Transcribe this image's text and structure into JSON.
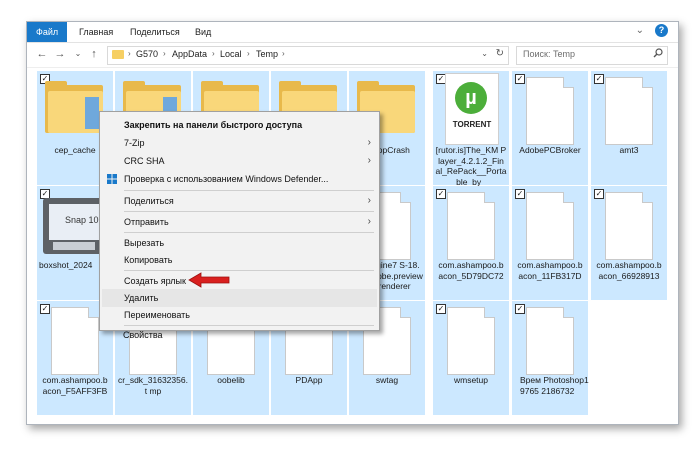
{
  "ribbon": {
    "tabs": [
      "Файл",
      "Главная",
      "Поделиться",
      "Вид"
    ],
    "collapse_icon": "chevron-down-icon",
    "help_label": "?"
  },
  "address": {
    "breadcrumb": [
      "G570",
      "AppData",
      "Local",
      "Temp"
    ],
    "search_placeholder": "Поиск: Temp"
  },
  "files": [
    {
      "label": "cep_cache",
      "type": "folder",
      "checked": true
    },
    {
      "label": "",
      "type": "folder",
      "checked": false
    },
    {
      "label": "",
      "type": "folder",
      "checked": false
    },
    {
      "label": "",
      "type": "folder",
      "checked": false
    },
    {
      "label": "oshopCrash",
      "type": "folder",
      "checked": false
    },
    {
      "label": "[rutor.is]The_KM Player_4.2.1.2_Fin al_RePack__Porta ble_by_",
      "type": "torrent",
      "checked": true
    },
    {
      "label": "AdobePCBroker",
      "type": "doc",
      "checked": true
    },
    {
      "label": "amt3",
      "type": "doc",
      "checked": true
    },
    {
      "label": "boxshot_2024",
      "type": "snap",
      "checked": true
    },
    {
      "label": "tmlEngine7 S-18.1.1-co obe.preview her-renderer",
      "type": "doc",
      "checked": false
    },
    {
      "label": "com.ashampoo.b acon_5D79DC72",
      "type": "doc",
      "checked": true
    },
    {
      "label": "com.ashampoo.b acon_11FB317D",
      "type": "doc",
      "checked": true
    },
    {
      "label": "com.ashampoo.b acon_66928913",
      "type": "doc",
      "checked": true
    },
    {
      "label": "com.ashampoo.b acon_F5AFF3FB",
      "type": "doc",
      "checked": true
    },
    {
      "label": "cr_sdk_31632356.t mp",
      "type": "doc",
      "checked": true
    },
    {
      "label": "oobelib",
      "type": "doc",
      "checked": true
    },
    {
      "label": "PDApp",
      "type": "doc",
      "checked": true
    },
    {
      "label": "swtag",
      "type": "doc",
      "checked": true
    },
    {
      "label": "wmsetup",
      "type": "doc",
      "checked": true
    },
    {
      "label": "Врем Photoshop19765 2186732",
      "type": "doc",
      "checked": true
    }
  ],
  "snap_text": "Snap 10",
  "torrent_text": "TORRENT",
  "torrent_logo": "µ",
  "context_menu": {
    "pin": "Закрепить на панели быстрого доступа",
    "zip": "7-Zip",
    "crc": "CRC SHA",
    "defender": "Проверка с использованием Windows Defender...",
    "share": "Поделиться",
    "send_to": "Отправить",
    "cut": "Вырезать",
    "copy": "Копировать",
    "shortcut": "Создать ярлык",
    "delete": "Удалить",
    "rename": "Переименовать",
    "properties": "Свойства"
  },
  "colors": {
    "selection": "#cce8ff",
    "accent": "#1979ca",
    "arrow": "#d9201f"
  }
}
